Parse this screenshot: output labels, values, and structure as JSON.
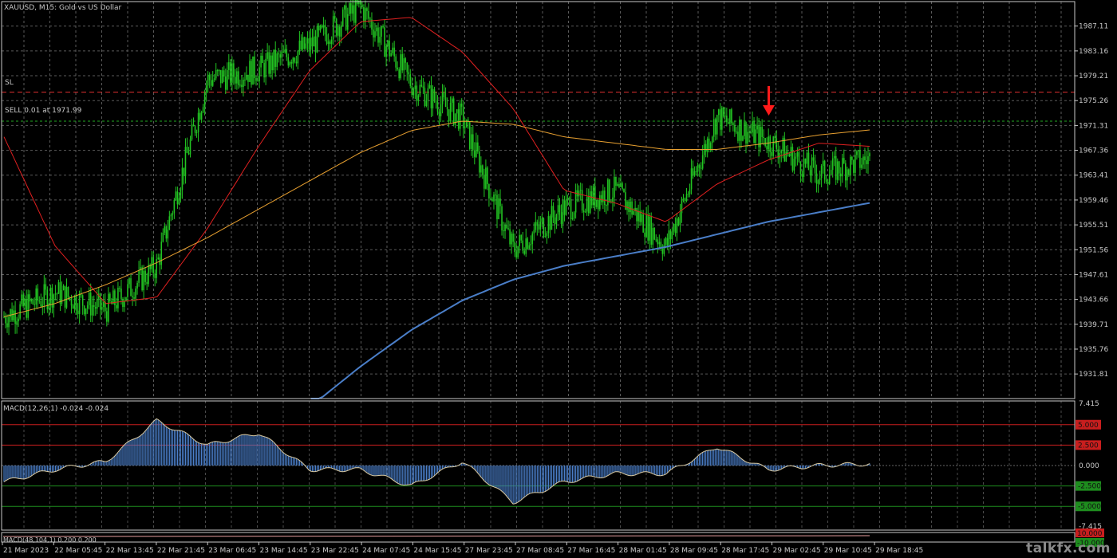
{
  "header": {
    "title": "XAUUSD, M15:  Gold vs US Dollar"
  },
  "price_panel": {
    "sl_label": "SL",
    "order_label": "SELL 0.01 at 1971.99",
    "price_ticks": [
      "1987.11",
      "1983.16",
      "1979.21",
      "1975.26",
      "1971.31",
      "1967.36",
      "1963.41",
      "1959.46",
      "1955.51",
      "1951.56",
      "1947.61",
      "1943.66",
      "1939.71",
      "1935.76",
      "1931.81"
    ],
    "colors": {
      "bull_candle": "#22c422",
      "sl_line": "#e03030",
      "order_line": "#22aa22",
      "ma_fast": "#e02020",
      "ma_mid": "#e8a030",
      "ma_slow": "#4a7ec8",
      "signal_arrow": "#ff1a1a"
    }
  },
  "macd_panel": {
    "title": "MACD(12,26,1) -0.024 -0.024",
    "ticks": [
      "7.415",
      "0.000",
      "-7.415"
    ],
    "levels": [
      {
        "label": "5.000",
        "value": 5.0,
        "color": "#c81e1e"
      },
      {
        "label": "2.500",
        "value": 2.5,
        "color": "#c81e1e"
      },
      {
        "label": "-2.500",
        "value": -2.5,
        "color": "#1e8c1e"
      },
      {
        "label": "-5.000",
        "value": -5.0,
        "color": "#1e8c1e"
      }
    ],
    "histogram_color": "#4a7ec8"
  },
  "macd2_panel": {
    "title": "MACD(48,104,1) 0.200 0.200",
    "levels": [
      {
        "label": "10.000",
        "color": "#c81e1e"
      },
      {
        "label": "-10.000",
        "color": "#1e8c1e"
      }
    ]
  },
  "time_axis": {
    "labels": [
      "21 Mar 2023",
      "22 Mar 05:45",
      "22 Mar 13:45",
      "22 Mar 21:45",
      "23 Mar 06:45",
      "23 Mar 14:45",
      "23 Mar 22:45",
      "24 Mar 07:45",
      "24 Mar 15:45",
      "27 Mar 23:45",
      "27 Mar 08:45",
      "27 Mar 16:45",
      "28 Mar 01:45",
      "28 Mar 09:45",
      "28 Mar 17:45",
      "29 Mar 02:45",
      "29 Mar 10:45",
      "29 Mar 18:45"
    ]
  },
  "watermark": "talkfx.com",
  "chart_data": [
    {
      "type": "line",
      "title": "XAUUSD, M15:  Gold vs US Dollar",
      "x": [
        "21 Mar 2023",
        "22 Mar 05:45",
        "22 Mar 13:45",
        "22 Mar 21:45",
        "23 Mar 06:45",
        "23 Mar 14:45",
        "23 Mar 22:45",
        "24 Mar 07:45",
        "24 Mar 15:45",
        "27 Mar 23:45",
        "27 Mar 08:45",
        "27 Mar 16:45",
        "28 Mar 01:45",
        "28 Mar 09:45",
        "28 Mar 17:45",
        "29 Mar 02:45",
        "29 Mar 10:45",
        "29 Mar 18:45"
      ],
      "ylim": [
        1927.9,
        1991.0
      ],
      "series": [
        {
          "values": [
            1940.9,
            1944.8,
            1942.0,
            1949.0,
            1978.6,
            1980.2,
            1984.0,
            1990.2,
            1978.0,
            1972.4,
            1951.6,
            1958.2,
            1961.0,
            1952.0,
            1972.6,
            1968.9,
            1963.5,
            1966.0
          ]
        },
        {
          "values": [
            1969.5,
            1952.2,
            1943.0,
            1944.0,
            1955.0,
            1968.0,
            1980.0,
            1987.8,
            1988.5,
            1983.0,
            1974.0,
            1961.0,
            1959.0,
            1956.0,
            1962.0,
            1965.8,
            1968.5,
            1968.0
          ]
        },
        {
          "values": [
            1940.9,
            1943.0,
            1946.0,
            1949.5,
            1953.5,
            1958.0,
            1962.5,
            1967.0,
            1970.5,
            1972.0,
            1971.5,
            1969.5,
            1968.5,
            1967.5,
            1967.5,
            1968.5,
            1969.8,
            1970.6
          ]
        },
        {
          "values": [
            null,
            null,
            null,
            null,
            null,
            null,
            1926.5,
            1933.0,
            1938.8,
            1943.5,
            1946.8,
            1949.0,
            1950.5,
            1952.0,
            1954.0,
            1956.0,
            1957.5,
            1959.0
          ]
        }
      ]
    },
    {
      "type": "bar",
      "title": "MACD(12,26,1) -0.024 -0.024",
      "categories": [
        "21 Mar 2023",
        "22 Mar 05:45",
        "22 Mar 13:45",
        "22 Mar 21:45",
        "23 Mar 06:45",
        "23 Mar 14:45",
        "23 Mar 22:45",
        "24 Mar 07:45",
        "24 Mar 15:45",
        "27 Mar 23:45",
        "27 Mar 08:45",
        "27 Mar 16:45",
        "28 Mar 01:45",
        "28 Mar 09:45",
        "28 Mar 17:45",
        "29 Mar 02:45",
        "29 Mar 10:45",
        "29 Mar 18:45"
      ],
      "values": [
        -2.0,
        -0.5,
        0.5,
        5.5,
        2.5,
        4.0,
        -0.5,
        -0.5,
        -2.5,
        0.5,
        -4.5,
        -2.0,
        -1.0,
        -1.0,
        2.3,
        -0.5,
        0.0,
        0.2
      ],
      "ylim": [
        -7.415,
        7.415
      ]
    }
  ]
}
